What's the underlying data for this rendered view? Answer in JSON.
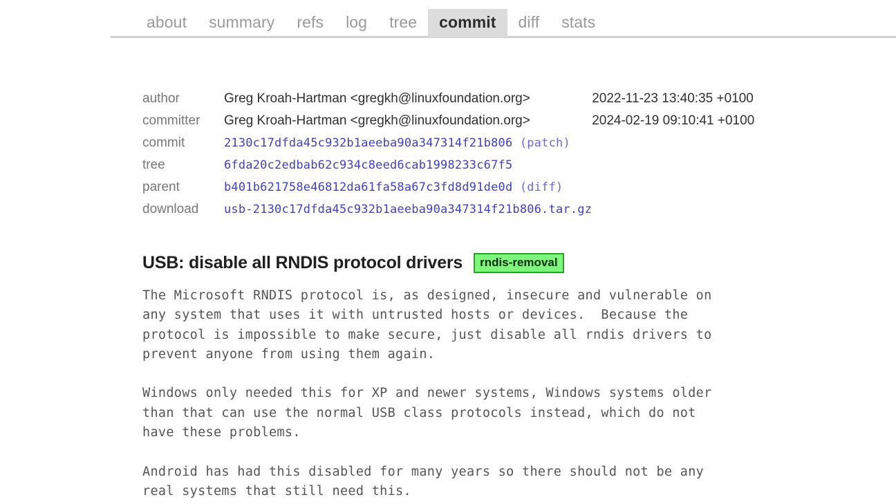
{
  "nav": {
    "tabs": [
      {
        "label": "about",
        "active": false
      },
      {
        "label": "summary",
        "active": false
      },
      {
        "label": "refs",
        "active": false
      },
      {
        "label": "log",
        "active": false
      },
      {
        "label": "tree",
        "active": false
      },
      {
        "label": "commit",
        "active": true
      },
      {
        "label": "diff",
        "active": false
      },
      {
        "label": "stats",
        "active": false
      }
    ]
  },
  "commit_info": {
    "rows": [
      {
        "label": "author",
        "value": "Greg Kroah-Hartman <gregkh@linuxfoundation.org>",
        "date": "2022-11-23 13:40:35 +0100"
      },
      {
        "label": "committer",
        "value": "Greg Kroah-Hartman <gregkh@linuxfoundation.org>",
        "date": "2024-02-19 09:10:41 +0100"
      },
      {
        "label": "commit",
        "value": "2130c17dfda45c932b1aeeba90a347314f21b806",
        "suffix": "(patch)",
        "date": ""
      },
      {
        "label": "tree",
        "value": "6fda20c2edbab62c934c8eed6cab1998233c67f5",
        "suffix": "",
        "date": ""
      },
      {
        "label": "parent",
        "value": "b401b621758e46812da61fa58a67c3fd8d91de0d",
        "suffix": "(diff)",
        "date": ""
      },
      {
        "label": "download",
        "value": "usb-2130c17dfda45c932b1aeeba90a347314f21b806.tar.gz",
        "suffix": "",
        "date": ""
      }
    ]
  },
  "commit": {
    "subject": "USB: disable all RNDIS protocol drivers",
    "decoration": "rndis-removal",
    "message": "The Microsoft RNDIS protocol is, as designed, insecure and vulnerable on\nany system that uses it with untrusted hosts or devices.  Because the\nprotocol is impossible to make secure, just disable all rndis drivers to\nprevent anyone from using them again.\n\nWindows only needed this for XP and newer systems, Windows systems older\nthan that can use the normal USB class protocols instead, which do not\nhave these problems.\n\nAndroid has had this disabled for many years so there should not be any\nreal systems that still need this."
  },
  "colors": {
    "link": "#4040c0",
    "label": "#777777",
    "body": "#555555",
    "tab_active_bg": "#dcdcdc",
    "decoration_bg": "#7cf77c",
    "decoration_border": "#2aa02a",
    "rule": "#cfcfcf"
  }
}
